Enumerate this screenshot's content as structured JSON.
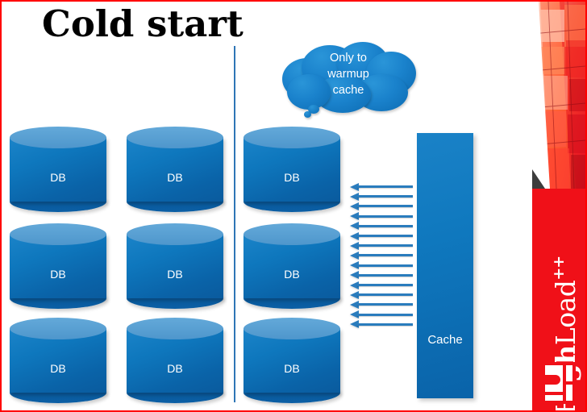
{
  "slide": {
    "title": "Cold start",
    "border_color": "#ff0000",
    "background": "#ffffff"
  },
  "callout": {
    "name": "thought-cloud",
    "text": "Only to warmup cache",
    "line1": "Only to",
    "line2": "warmup",
    "line3": "cache",
    "fill": "#1a82cc",
    "text_color": "#ffffff"
  },
  "divider": {
    "color": "#2e75b6"
  },
  "databases": {
    "label": "DB",
    "fill_top": "#5aa2d5",
    "fill_body": "#0e77bd",
    "items": [
      {
        "label": "DB",
        "col": 0,
        "row": 0
      },
      {
        "label": "DB",
        "col": 1,
        "row": 0
      },
      {
        "label": "DB",
        "col": 2,
        "row": 0
      },
      {
        "label": "DB",
        "col": 0,
        "row": 1
      },
      {
        "label": "DB",
        "col": 1,
        "row": 1
      },
      {
        "label": "DB",
        "col": 2,
        "row": 1
      },
      {
        "label": "DB",
        "col": 0,
        "row": 2
      },
      {
        "label": "DB",
        "col": 1,
        "row": 2
      },
      {
        "label": "DB",
        "col": 2,
        "row": 2
      }
    ]
  },
  "cache": {
    "label": "Cache",
    "fill": "#0f78be",
    "text_color": "#ffffff"
  },
  "arrows": {
    "count": 15,
    "direction": "left",
    "color": "#2a7cbd"
  },
  "branding": {
    "panel_color": "#f01018",
    "name_bold": "High",
    "name_light": "Load",
    "suffix": "++",
    "text_color": "#ffffff"
  }
}
